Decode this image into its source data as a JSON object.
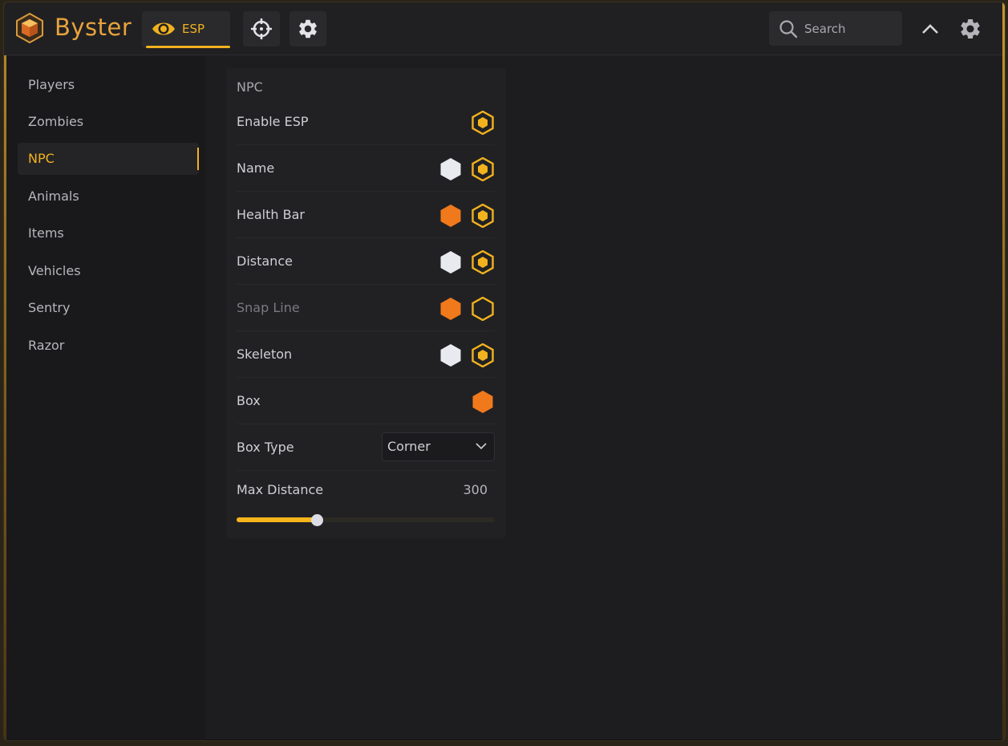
{
  "app": {
    "brand": "Byster",
    "accent": "#f2b21e",
    "orange": "#f0791c",
    "brand_color": "#e8a23c"
  },
  "toolbar": {
    "esp_tab_label": "ESP",
    "esp_tab_icon": "eye-icon",
    "aim_tab_icon": "crosshair-icon",
    "settings_tab_icon": "gear-icon",
    "search_placeholder": "Search",
    "collapse_icon": "chevron-up-icon",
    "settings_icon": "gear-icon"
  },
  "sidebar": {
    "items": [
      {
        "label": "Players",
        "active": false
      },
      {
        "label": "Zombies",
        "active": false
      },
      {
        "label": "NPC",
        "active": true
      },
      {
        "label": "Animals",
        "active": false
      },
      {
        "label": "Items",
        "active": false
      },
      {
        "label": "Vehicles",
        "active": false
      },
      {
        "label": "Sentry",
        "active": false
      },
      {
        "label": "Razor",
        "active": false
      }
    ]
  },
  "panel": {
    "title": "NPC",
    "rows": [
      {
        "label": "Enable ESP",
        "toggle": "on"
      },
      {
        "label": "Name",
        "color": "#e8eaf0",
        "toggle": "on"
      },
      {
        "label": "Health Bar",
        "color": "#f0791c",
        "toggle": "on"
      },
      {
        "label": "Distance",
        "color": "#e8eaf0",
        "toggle": "on"
      },
      {
        "label": "Snap Line",
        "color": "#f0791c",
        "toggle": "off",
        "dim": true
      },
      {
        "label": "Skeleton",
        "color": "#e8eaf0",
        "toggle": "on"
      },
      {
        "label": "Box",
        "color": "#f0791c"
      }
    ],
    "box_type": {
      "label": "Box Type",
      "value": "Corner"
    },
    "max_distance": {
      "label": "Max Distance",
      "value": "300",
      "fraction": 0.31
    }
  }
}
